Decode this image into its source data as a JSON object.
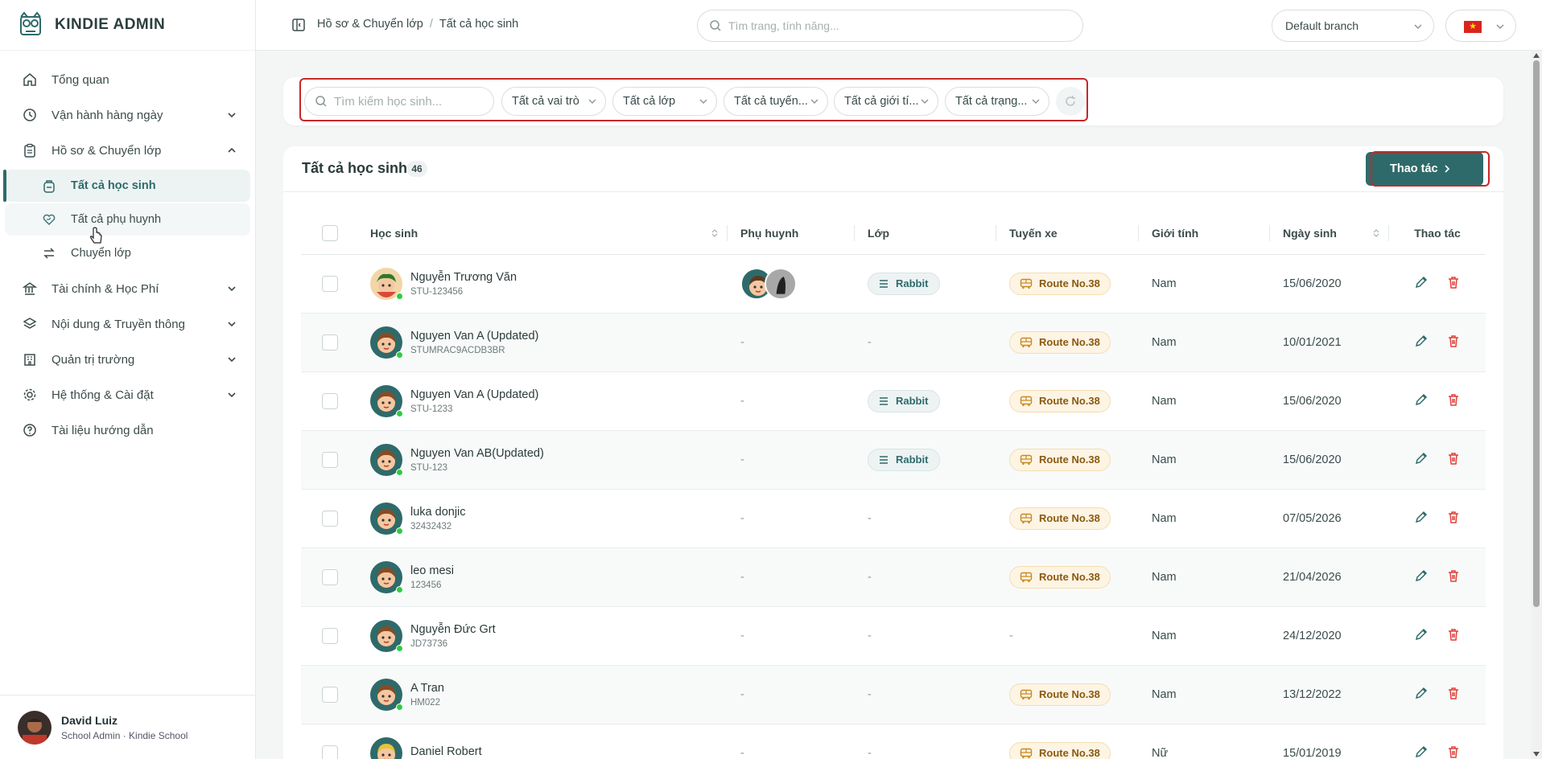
{
  "app": {
    "brand": "KINDIE ADMIN"
  },
  "sidebar": {
    "items": [
      {
        "label": "Tổng quan",
        "icon": "home-icon"
      },
      {
        "label": "Vận hành hàng ngày",
        "icon": "clock-icon"
      },
      {
        "label": "Hồ sơ & Chuyển lớp",
        "icon": "clipboard-icon"
      },
      {
        "label": "Tài chính & Học Phí",
        "icon": "bank-icon"
      },
      {
        "label": "Nội dung & Truyền thông",
        "icon": "layers-icon"
      },
      {
        "label": "Quản trị trường",
        "icon": "building-icon"
      },
      {
        "label": "Hệ thống & Cài đặt",
        "icon": "gear-icon"
      },
      {
        "label": "Tài liệu hướng dẫn",
        "icon": "help-circle-icon"
      }
    ],
    "subitems": [
      {
        "label": "Tất cả học sinh",
        "icon": "backpack-icon"
      },
      {
        "label": "Tất cả phụ huynh",
        "icon": "heart-hand-icon"
      },
      {
        "label": "Chuyển lớp",
        "icon": "swap-icon"
      }
    ],
    "user": {
      "name": "David Luiz",
      "role": "School Admin · Kindie School"
    }
  },
  "header": {
    "breadcrumb": [
      "Hồ sơ & Chuyển lớp",
      "Tất cả học sinh"
    ],
    "search_placeholder": "Tìm trang, tính năng...",
    "branch": "Default branch"
  },
  "filters": {
    "search_placeholder": "Tìm kiếm học sinh...",
    "selects": [
      "Tất cả vai trò",
      "Tất cả lớp",
      "Tất cả tuyến...",
      "Tất cả giới tí...",
      "Tất cả trạng..."
    ]
  },
  "table_card": {
    "title": "Tất cả học sinh",
    "count": "46",
    "action_label": "Thao tác",
    "columns": [
      "Học sinh",
      "Phụ huynh",
      "Lớp",
      "Tuyến xe",
      "Giới tính",
      "Ngày sinh",
      "Thao tác"
    ],
    "rows": [
      {
        "name": "Nguyễn Trương Văn",
        "code": "STU-123456",
        "parent": "avatars",
        "class": "Rabbit",
        "route": "Route No.38",
        "gender": "Nam",
        "dob": "15/06/2020"
      },
      {
        "name": "Nguyen Van A (Updated)",
        "code": "STUMRAC9ACDB3BR",
        "parent": "-",
        "class": "-",
        "route": "Route No.38",
        "gender": "Nam",
        "dob": "10/01/2021"
      },
      {
        "name": "Nguyen Van A (Updated)",
        "code": "STU-1233",
        "parent": "-",
        "class": "Rabbit",
        "route": "Route No.38",
        "gender": "Nam",
        "dob": "15/06/2020"
      },
      {
        "name": "Nguyen Van AB(Updated)",
        "code": "STU-123",
        "parent": "-",
        "class": "Rabbit",
        "route": "Route No.38",
        "gender": "Nam",
        "dob": "15/06/2020"
      },
      {
        "name": "luka donjic",
        "code": "32432432",
        "parent": "-",
        "class": "-",
        "route": "Route No.38",
        "gender": "Nam",
        "dob": "07/05/2026"
      },
      {
        "name": "leo mesi",
        "code": "123456",
        "parent": "-",
        "class": "-",
        "route": "Route No.38",
        "gender": "Nam",
        "dob": "21/04/2026"
      },
      {
        "name": "Nguyễn Đức Grt",
        "code": "JD73736",
        "parent": "-",
        "class": "-",
        "route": "-",
        "gender": "Nam",
        "dob": "24/12/2020"
      },
      {
        "name": "A Tran",
        "code": "HM022",
        "parent": "-",
        "class": "-",
        "route": "Route No.38",
        "gender": "Nam",
        "dob": "13/12/2022"
      },
      {
        "name": "Daniel Robert",
        "code": "",
        "parent": "-",
        "class": "-",
        "route": "Route No.38",
        "gender": "Nữ",
        "dob": "15/01/2019"
      }
    ]
  },
  "colors": {
    "accent": "#2f6a6a",
    "highlight": "#c62828",
    "route_bg": "#fdf4e4",
    "class_bg": "#edf3f3",
    "delete": "#e0413b"
  }
}
